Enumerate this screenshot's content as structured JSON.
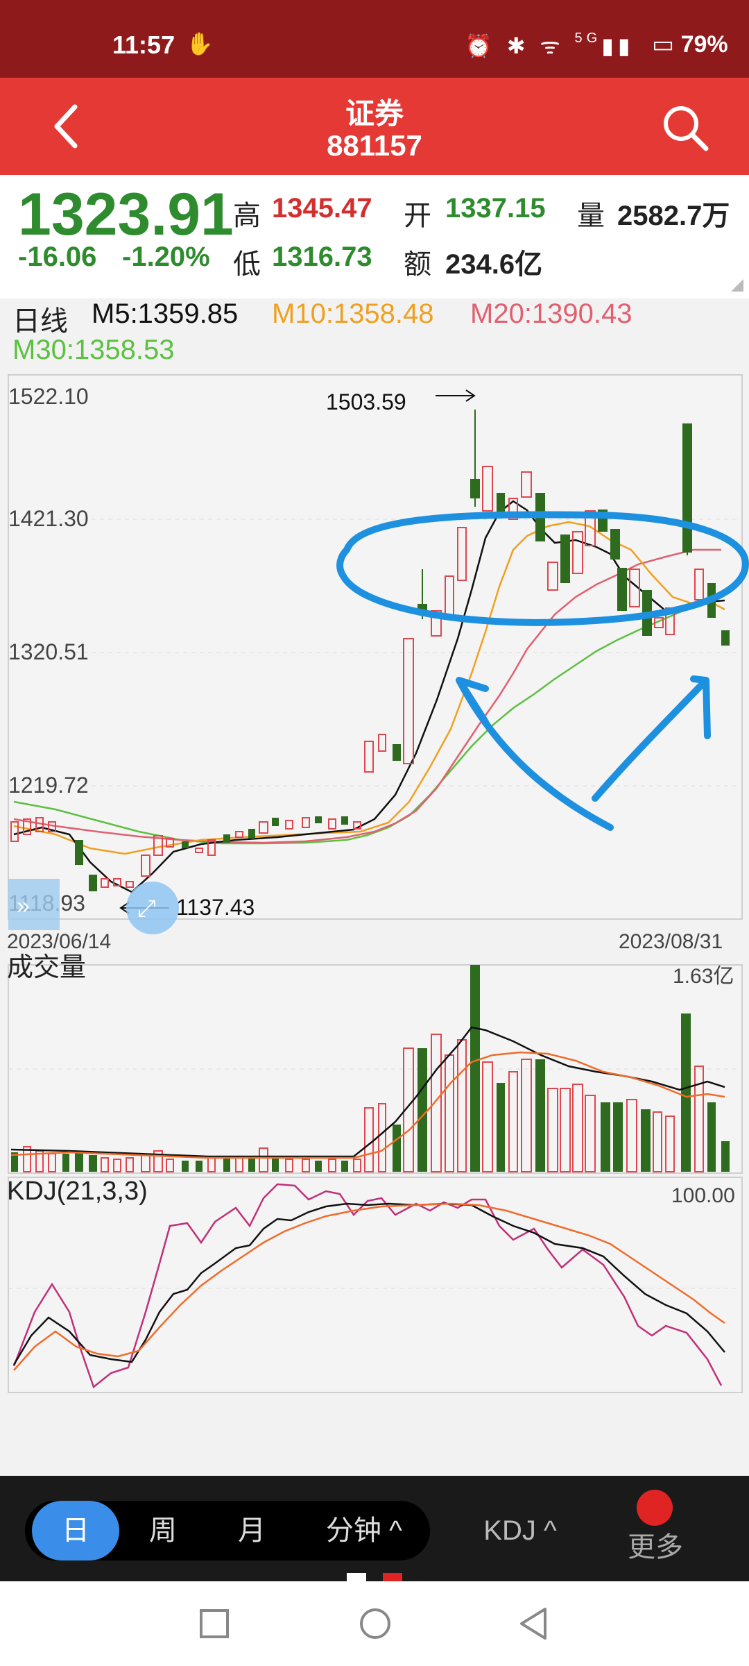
{
  "status": {
    "time": "11:57",
    "battery": "79%",
    "network": "5G"
  },
  "header": {
    "title": "证券",
    "code": "881157"
  },
  "quote": {
    "price": "1323.91",
    "change": "-16.06",
    "change_pct": "-1.20%",
    "high_label": "高",
    "high": "1345.47",
    "open_label": "开",
    "open": "1337.15",
    "volume_label": "量",
    "volume": "2582.7万",
    "low_label": "低",
    "low": "1316.73",
    "amount_label": "额",
    "amount": "234.6亿"
  },
  "ma_legend": {
    "period": "日线",
    "m5": "M5:1359.85",
    "m10": "M10:1358.48",
    "m20": "M20:1390.43",
    "m30": "M30:1358.53",
    "colors": {
      "m5": "#111111",
      "m10": "#f0a020",
      "m20": "#e06070",
      "m30": "#5cc040"
    }
  },
  "kline": {
    "y_ticks": [
      "1522.10",
      "1421.30",
      "1320.51",
      "1219.72",
      "1118.93"
    ],
    "high_marker": "1503.59",
    "low_marker": "1137.43",
    "date_start": "2023/06/14",
    "date_end": "2023/08/31"
  },
  "volume_panel": {
    "title": "成交量",
    "max_label": "1.63亿"
  },
  "kdj_panel": {
    "title": "KDJ(21,3,3)",
    "max_label": "100.00"
  },
  "tabs": {
    "day": "日",
    "week": "周",
    "month": "月",
    "minute": "分钟 ^",
    "kdj": "KDJ ^",
    "more": "更多"
  },
  "colors": {
    "up": "#e0464e",
    "down": "#2e6b1e",
    "annotation": "#1e90e0",
    "accent": "#e53935"
  }
}
